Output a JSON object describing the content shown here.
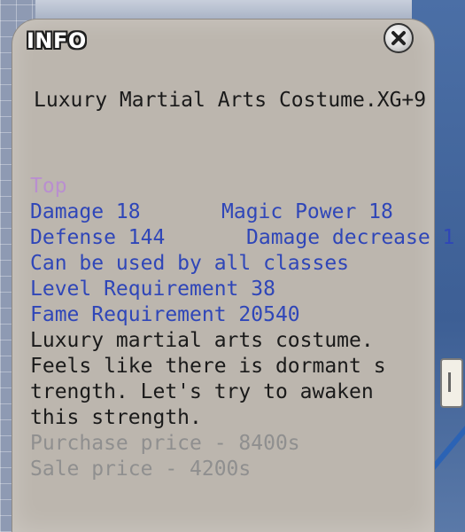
{
  "window": {
    "title": "INFO",
    "close_icon": "close-icon"
  },
  "item": {
    "name": "Luxury Martial Arts Costume.XG+9",
    "category": "Top",
    "stats": {
      "damage": "Damage 18",
      "magic_power": "Magic Power 18",
      "defense": "Defense 144",
      "damage_decrease": "Damage decrease 1"
    },
    "class_restriction": "Can be used by all classes",
    "level_requirement": "Level Requirement 38",
    "fame_requirement": "Fame Requirement 20540",
    "description": [
      "Luxury martial arts costume.",
      "Feels like there is dormant s",
      "trength. Let's try to awaken",
      "this strength."
    ],
    "purchase_price": "Purchase price - 8400s",
    "sale_price": "Sale price - 4200s"
  },
  "colors": {
    "panel": "#bcb6ae",
    "stat_text": "#2f46b8",
    "category_text": "#b98fcf",
    "description_text": "#1a1a1a",
    "price_text": "#8f8f8f"
  }
}
